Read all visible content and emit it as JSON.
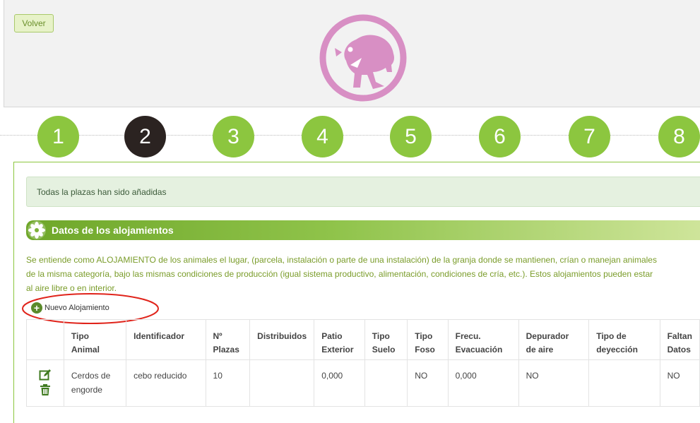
{
  "header": {
    "back_label": "Volver"
  },
  "colors": {
    "accent": "#8cc63f",
    "logo": "#d88fc4",
    "active_step": "#2b2321"
  },
  "steps": [
    "1",
    "2",
    "3",
    "4",
    "5",
    "6",
    "7",
    "8"
  ],
  "active_step": "2",
  "alert": {
    "text": "Todas la plazas han sido añadidas"
  },
  "section": {
    "title": "Datos de los alojamientos",
    "description_lines": [
      "Se entiende como ALOJAMIENTO de los animales el lugar, (parcela, instalación o parte de una instalación) de la granja donde se mantienen, crían o manejan animales",
      "de la misma categoría, bajo las mismas condiciones de producción (igual sistema productivo, alimentación, condiciones de cría, etc.). Estos alojamientos pueden estar",
      "al aire libre o en interior."
    ]
  },
  "new_button": {
    "label": "Nuevo Alojamiento"
  },
  "table": {
    "headers": [
      [
        "Tipo Animal"
      ],
      [
        "Identificador"
      ],
      [
        "Nº",
        "Plazas"
      ],
      [
        "Distribuidos"
      ],
      [
        "Patio",
        "Exterior"
      ],
      [
        "Tipo",
        "Suelo"
      ],
      [
        "Tipo",
        "Foso"
      ],
      [
        "Frecu.",
        "Evacuación"
      ],
      [
        "Depurador",
        "de aire"
      ],
      [
        "Tipo de",
        "deyección"
      ],
      [
        "Faltan",
        "Datos"
      ]
    ],
    "rows": [
      {
        "tipo_animal": [
          "Cerdos de",
          "engorde"
        ],
        "identificador": "cebo reducido",
        "plazas": "10",
        "distribuidos": "",
        "patio_exterior": "0,000",
        "tipo_suelo": "",
        "tipo_foso": "NO",
        "frecuencia": "0,000",
        "depurador": "NO",
        "tipo_deyeccion": "",
        "faltan_datos": "NO"
      }
    ]
  },
  "icons": {
    "edit": "edit-icon",
    "delete": "trash-icon",
    "add": "plus-circle-icon",
    "logo": "pig-logo",
    "section": "leaf-badge-icon"
  }
}
